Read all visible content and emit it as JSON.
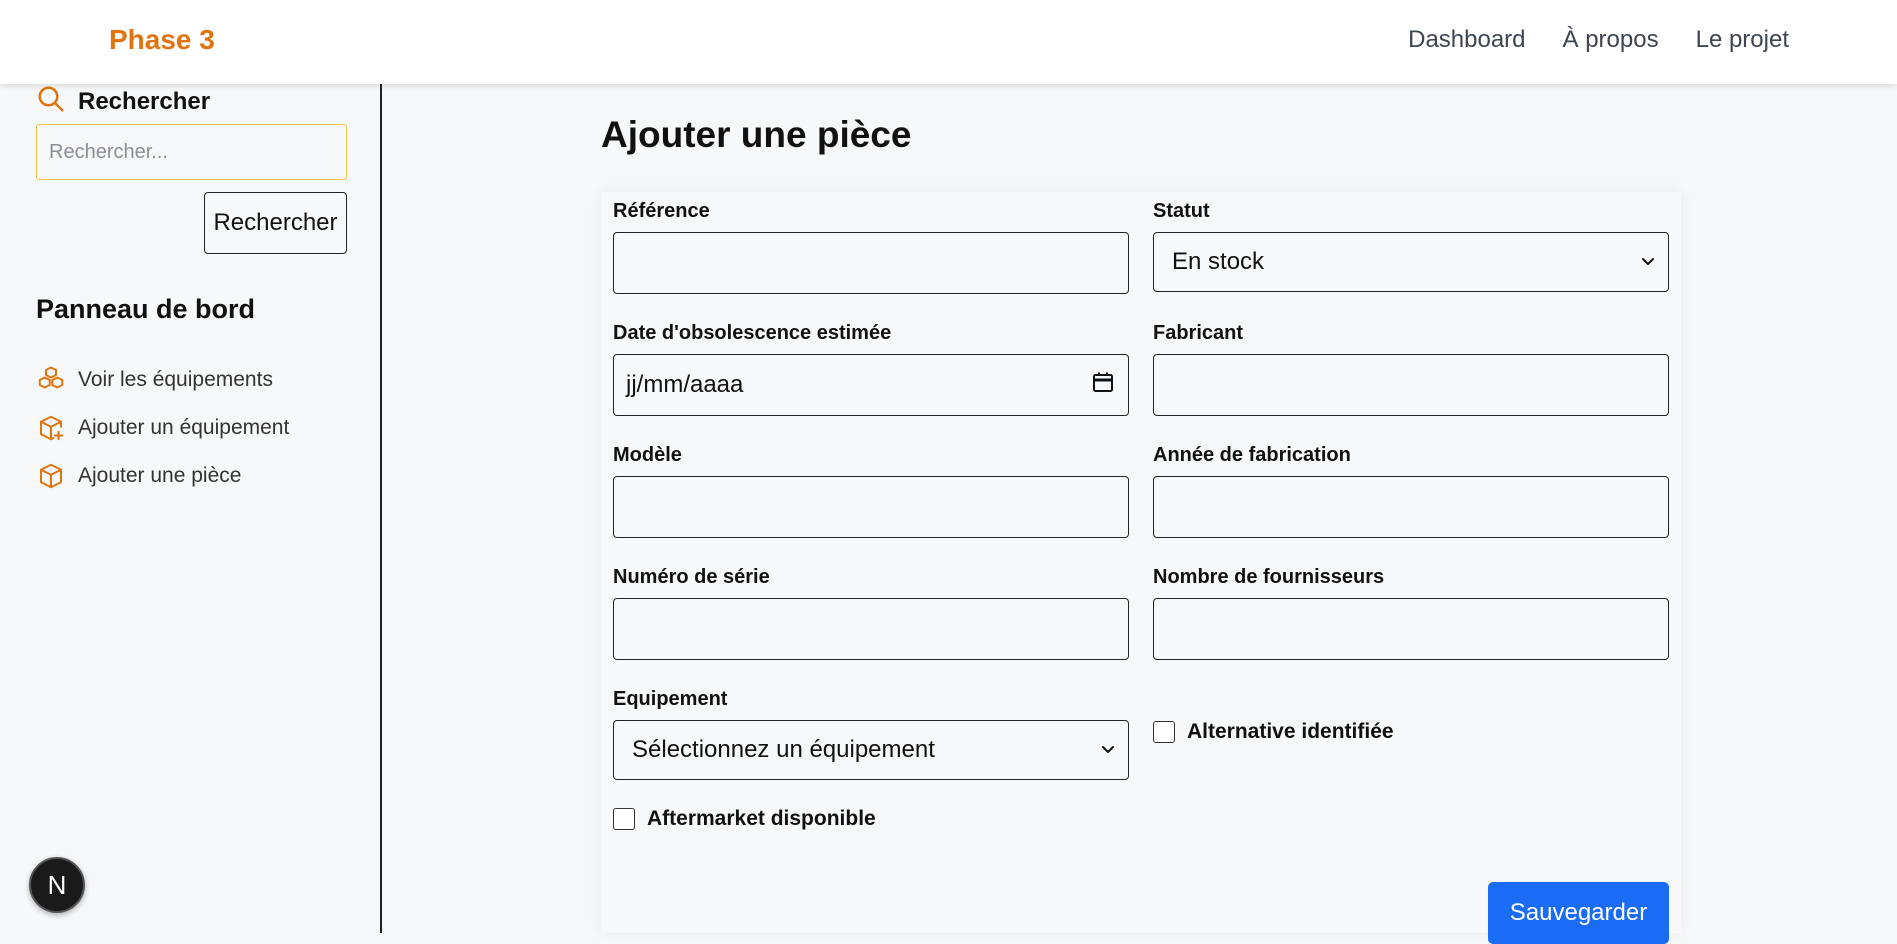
{
  "header": {
    "brand": "Phase 3",
    "nav": [
      "Dashboard",
      "À propos",
      "Le projet"
    ]
  },
  "sidebar": {
    "search_label": "Rechercher",
    "search_placeholder": "Rechercher...",
    "search_button": "Rechercher",
    "panel_title": "Panneau de bord",
    "items": [
      {
        "label": "Voir les équipements",
        "icon": "boxes-icon"
      },
      {
        "label": "Ajouter un équipement",
        "icon": "package-plus-icon"
      },
      {
        "label": "Ajouter une pièce",
        "icon": "package-icon"
      }
    ]
  },
  "badge": {
    "letter": "N"
  },
  "form": {
    "title": "Ajouter une pièce",
    "reference": {
      "label": "Référence",
      "value": ""
    },
    "statut": {
      "label": "Statut",
      "value": "En stock"
    },
    "date_obsolescence": {
      "label": "Date d'obsolescence estimée",
      "placeholder": "jj/mm/aaaa"
    },
    "fabricant": {
      "label": "Fabricant",
      "value": ""
    },
    "modele": {
      "label": "Modèle",
      "value": ""
    },
    "annee": {
      "label": "Année de fabrication",
      "value": ""
    },
    "numero_serie": {
      "label": "Numéro de série",
      "value": ""
    },
    "nombre_fournisseurs": {
      "label": "Nombre de fournisseurs",
      "value": ""
    },
    "equipement": {
      "label": "Equipement",
      "value": "Sélectionnez un équipement"
    },
    "alternative": {
      "label": "Alternative identifiée",
      "checked": false
    },
    "aftermarket": {
      "label": "Aftermarket disponible",
      "checked": false
    },
    "save_button": "Sauvegarder"
  },
  "colors": {
    "accent": "#e07410",
    "primary": "#1a6cf5"
  }
}
